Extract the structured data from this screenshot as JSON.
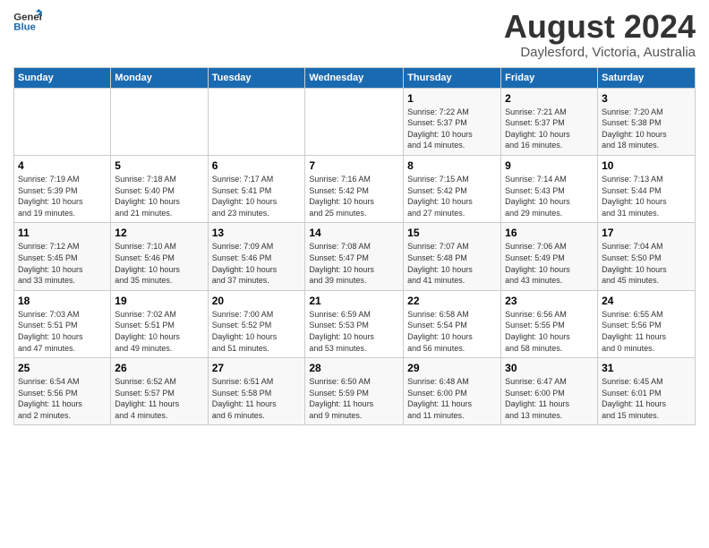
{
  "header": {
    "logo_line1": "General",
    "logo_line2": "Blue",
    "main_title": "August 2024",
    "subtitle": "Daylesford, Victoria, Australia"
  },
  "days_of_week": [
    "Sunday",
    "Monday",
    "Tuesday",
    "Wednesday",
    "Thursday",
    "Friday",
    "Saturday"
  ],
  "weeks": [
    [
      {
        "day": "",
        "detail": ""
      },
      {
        "day": "",
        "detail": ""
      },
      {
        "day": "",
        "detail": ""
      },
      {
        "day": "",
        "detail": ""
      },
      {
        "day": "1",
        "detail": "Sunrise: 7:22 AM\nSunset: 5:37 PM\nDaylight: 10 hours\nand 14 minutes."
      },
      {
        "day": "2",
        "detail": "Sunrise: 7:21 AM\nSunset: 5:37 PM\nDaylight: 10 hours\nand 16 minutes."
      },
      {
        "day": "3",
        "detail": "Sunrise: 7:20 AM\nSunset: 5:38 PM\nDaylight: 10 hours\nand 18 minutes."
      }
    ],
    [
      {
        "day": "4",
        "detail": "Sunrise: 7:19 AM\nSunset: 5:39 PM\nDaylight: 10 hours\nand 19 minutes."
      },
      {
        "day": "5",
        "detail": "Sunrise: 7:18 AM\nSunset: 5:40 PM\nDaylight: 10 hours\nand 21 minutes."
      },
      {
        "day": "6",
        "detail": "Sunrise: 7:17 AM\nSunset: 5:41 PM\nDaylight: 10 hours\nand 23 minutes."
      },
      {
        "day": "7",
        "detail": "Sunrise: 7:16 AM\nSunset: 5:42 PM\nDaylight: 10 hours\nand 25 minutes."
      },
      {
        "day": "8",
        "detail": "Sunrise: 7:15 AM\nSunset: 5:42 PM\nDaylight: 10 hours\nand 27 minutes."
      },
      {
        "day": "9",
        "detail": "Sunrise: 7:14 AM\nSunset: 5:43 PM\nDaylight: 10 hours\nand 29 minutes."
      },
      {
        "day": "10",
        "detail": "Sunrise: 7:13 AM\nSunset: 5:44 PM\nDaylight: 10 hours\nand 31 minutes."
      }
    ],
    [
      {
        "day": "11",
        "detail": "Sunrise: 7:12 AM\nSunset: 5:45 PM\nDaylight: 10 hours\nand 33 minutes."
      },
      {
        "day": "12",
        "detail": "Sunrise: 7:10 AM\nSunset: 5:46 PM\nDaylight: 10 hours\nand 35 minutes."
      },
      {
        "day": "13",
        "detail": "Sunrise: 7:09 AM\nSunset: 5:46 PM\nDaylight: 10 hours\nand 37 minutes."
      },
      {
        "day": "14",
        "detail": "Sunrise: 7:08 AM\nSunset: 5:47 PM\nDaylight: 10 hours\nand 39 minutes."
      },
      {
        "day": "15",
        "detail": "Sunrise: 7:07 AM\nSunset: 5:48 PM\nDaylight: 10 hours\nand 41 minutes."
      },
      {
        "day": "16",
        "detail": "Sunrise: 7:06 AM\nSunset: 5:49 PM\nDaylight: 10 hours\nand 43 minutes."
      },
      {
        "day": "17",
        "detail": "Sunrise: 7:04 AM\nSunset: 5:50 PM\nDaylight: 10 hours\nand 45 minutes."
      }
    ],
    [
      {
        "day": "18",
        "detail": "Sunrise: 7:03 AM\nSunset: 5:51 PM\nDaylight: 10 hours\nand 47 minutes."
      },
      {
        "day": "19",
        "detail": "Sunrise: 7:02 AM\nSunset: 5:51 PM\nDaylight: 10 hours\nand 49 minutes."
      },
      {
        "day": "20",
        "detail": "Sunrise: 7:00 AM\nSunset: 5:52 PM\nDaylight: 10 hours\nand 51 minutes."
      },
      {
        "day": "21",
        "detail": "Sunrise: 6:59 AM\nSunset: 5:53 PM\nDaylight: 10 hours\nand 53 minutes."
      },
      {
        "day": "22",
        "detail": "Sunrise: 6:58 AM\nSunset: 5:54 PM\nDaylight: 10 hours\nand 56 minutes."
      },
      {
        "day": "23",
        "detail": "Sunrise: 6:56 AM\nSunset: 5:55 PM\nDaylight: 10 hours\nand 58 minutes."
      },
      {
        "day": "24",
        "detail": "Sunrise: 6:55 AM\nSunset: 5:56 PM\nDaylight: 11 hours\nand 0 minutes."
      }
    ],
    [
      {
        "day": "25",
        "detail": "Sunrise: 6:54 AM\nSunset: 5:56 PM\nDaylight: 11 hours\nand 2 minutes."
      },
      {
        "day": "26",
        "detail": "Sunrise: 6:52 AM\nSunset: 5:57 PM\nDaylight: 11 hours\nand 4 minutes."
      },
      {
        "day": "27",
        "detail": "Sunrise: 6:51 AM\nSunset: 5:58 PM\nDaylight: 11 hours\nand 6 minutes."
      },
      {
        "day": "28",
        "detail": "Sunrise: 6:50 AM\nSunset: 5:59 PM\nDaylight: 11 hours\nand 9 minutes."
      },
      {
        "day": "29",
        "detail": "Sunrise: 6:48 AM\nSunset: 6:00 PM\nDaylight: 11 hours\nand 11 minutes."
      },
      {
        "day": "30",
        "detail": "Sunrise: 6:47 AM\nSunset: 6:00 PM\nDaylight: 11 hours\nand 13 minutes."
      },
      {
        "day": "31",
        "detail": "Sunrise: 6:45 AM\nSunset: 6:01 PM\nDaylight: 11 hours\nand 15 minutes."
      }
    ]
  ]
}
